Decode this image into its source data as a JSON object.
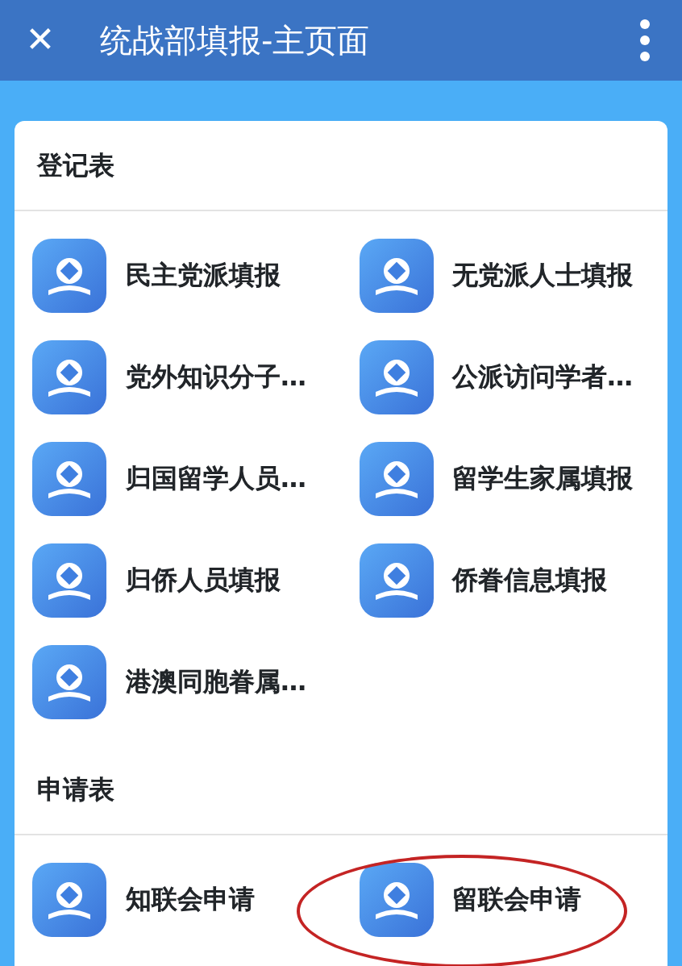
{
  "header": {
    "close": "✕",
    "title": "统战部填报-主页面"
  },
  "sections": [
    {
      "title": "登记表",
      "items": [
        {
          "label": "民主党派填报",
          "circled": false
        },
        {
          "label": "无党派人士填报",
          "circled": false
        },
        {
          "label": "党外知识分子…",
          "circled": false
        },
        {
          "label": "公派访问学者…",
          "circled": false
        },
        {
          "label": "归国留学人员…",
          "circled": false
        },
        {
          "label": "留学生家属填报",
          "circled": false
        },
        {
          "label": "归侨人员填报",
          "circled": false
        },
        {
          "label": "侨眷信息填报",
          "circled": false
        },
        {
          "label": "港澳同胞眷属…",
          "circled": false
        }
      ]
    },
    {
      "title": "申请表",
      "items": [
        {
          "label": "知联会申请",
          "circled": false
        },
        {
          "label": "留联会申请",
          "circled": true
        }
      ]
    }
  ]
}
